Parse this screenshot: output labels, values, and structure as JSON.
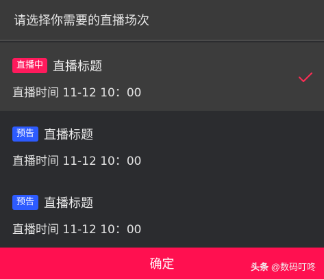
{
  "header": {
    "title": "请选择你需要的直播场次"
  },
  "items": [
    {
      "badge": "直播中",
      "badge_color": "#ff1a5c",
      "title": "直播标题",
      "time": "直播时间 11-12 10：00",
      "selected": true
    },
    {
      "badge": "预告",
      "badge_color": "#2d5bff",
      "title": "直播标题",
      "time": "直播时间 11-12 10：00",
      "selected": false
    },
    {
      "badge": "预告",
      "badge_color": "#2d5bff",
      "title": "直播标题",
      "time": "直播时间 11-12 10：00",
      "selected": false
    }
  ],
  "footer": {
    "confirm_label": "确定"
  },
  "watermark": {
    "brand": "头条",
    "handle": "@数码叮咚"
  },
  "colors": {
    "accent": "#ff1050",
    "check": "#ff2d55"
  },
  "icons": {
    "selected": "checkmark-icon"
  }
}
